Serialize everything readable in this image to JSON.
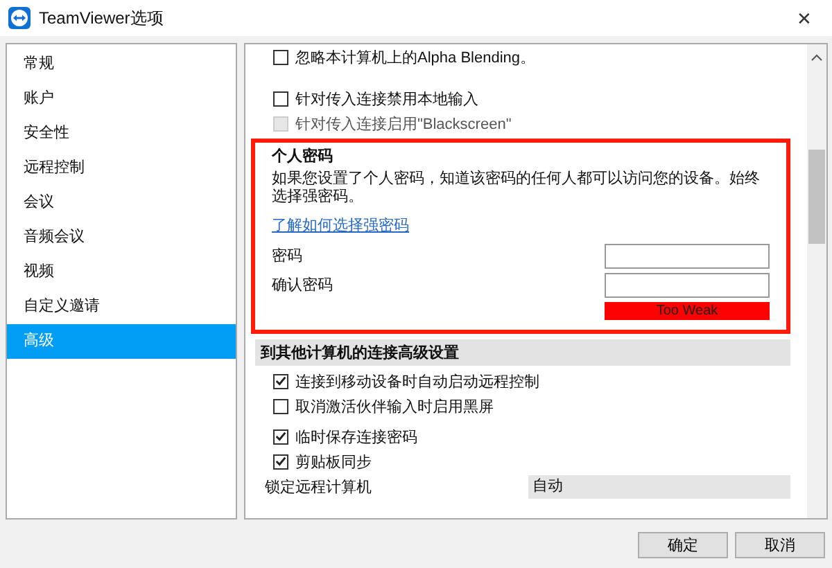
{
  "window": {
    "title": "TeamViewer选项",
    "close": "✕"
  },
  "sidebar": {
    "items": [
      {
        "label": "常规",
        "selected": false
      },
      {
        "label": "账户",
        "selected": false
      },
      {
        "label": "安全性",
        "selected": false
      },
      {
        "label": "远程控制",
        "selected": false
      },
      {
        "label": "会议",
        "selected": false
      },
      {
        "label": "音频会议",
        "selected": false
      },
      {
        "label": "视频",
        "selected": false
      },
      {
        "label": "自定义邀请",
        "selected": false
      },
      {
        "label": "高级",
        "selected": true
      }
    ]
  },
  "top_options": [
    {
      "label": "忽略本计算机上的Alpha Blending。",
      "checked": false,
      "disabled": false
    },
    {
      "label": "针对传入连接禁用本地输入",
      "checked": false,
      "disabled": false
    },
    {
      "label": "针对传入连接启用\"Blackscreen\"",
      "checked": false,
      "disabled": true
    }
  ],
  "personal_password": {
    "title": "个人密码",
    "description": "如果您设置了个人密码，知道该密码的任何人都可以访问您的设备。始终选择强密码。",
    "link": "了解如何选择强密码",
    "password_label": "密码",
    "confirm_label": "确认密码",
    "strength": {
      "label": "Too Weak",
      "level": 1
    }
  },
  "advanced_section": {
    "title": "到其他计算机的连接高级设置",
    "options": [
      {
        "label": "连接到移动设备时自动启动远程控制",
        "checked": true,
        "disabled": false
      },
      {
        "label": "取消激活伙伴输入时启用黑屏",
        "checked": false,
        "disabled": false
      },
      {
        "label": "临时保存连接密码",
        "checked": true,
        "disabled": false
      },
      {
        "label": "剪贴板同步",
        "checked": true,
        "disabled": false
      }
    ],
    "lock_label": "锁定远程计算机",
    "lock_value": "自动"
  },
  "buttons": [
    "确定",
    "取消"
  ]
}
